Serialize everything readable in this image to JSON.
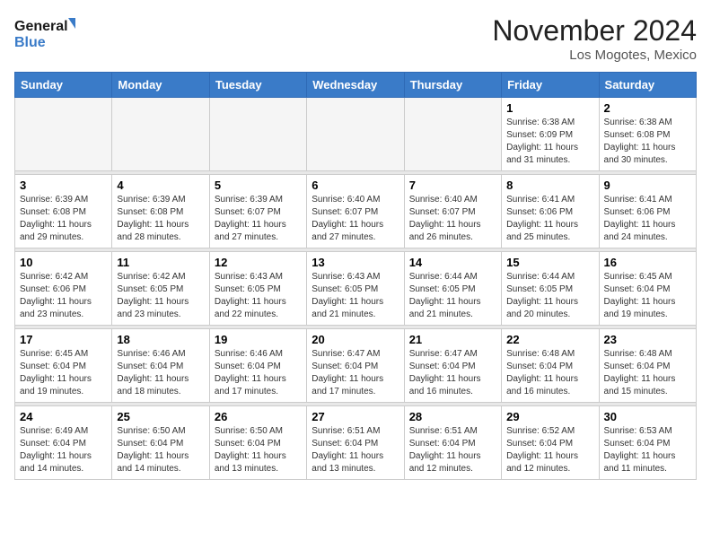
{
  "header": {
    "logo_line1": "General",
    "logo_line2": "Blue",
    "month": "November 2024",
    "location": "Los Mogotes, Mexico"
  },
  "days_of_week": [
    "Sunday",
    "Monday",
    "Tuesday",
    "Wednesday",
    "Thursday",
    "Friday",
    "Saturday"
  ],
  "weeks": [
    [
      {
        "day": "",
        "info": ""
      },
      {
        "day": "",
        "info": ""
      },
      {
        "day": "",
        "info": ""
      },
      {
        "day": "",
        "info": ""
      },
      {
        "day": "",
        "info": ""
      },
      {
        "day": "1",
        "info": "Sunrise: 6:38 AM\nSunset: 6:09 PM\nDaylight: 11 hours and 31 minutes."
      },
      {
        "day": "2",
        "info": "Sunrise: 6:38 AM\nSunset: 6:08 PM\nDaylight: 11 hours and 30 minutes."
      }
    ],
    [
      {
        "day": "3",
        "info": "Sunrise: 6:39 AM\nSunset: 6:08 PM\nDaylight: 11 hours and 29 minutes."
      },
      {
        "day": "4",
        "info": "Sunrise: 6:39 AM\nSunset: 6:08 PM\nDaylight: 11 hours and 28 minutes."
      },
      {
        "day": "5",
        "info": "Sunrise: 6:39 AM\nSunset: 6:07 PM\nDaylight: 11 hours and 27 minutes."
      },
      {
        "day": "6",
        "info": "Sunrise: 6:40 AM\nSunset: 6:07 PM\nDaylight: 11 hours and 27 minutes."
      },
      {
        "day": "7",
        "info": "Sunrise: 6:40 AM\nSunset: 6:07 PM\nDaylight: 11 hours and 26 minutes."
      },
      {
        "day": "8",
        "info": "Sunrise: 6:41 AM\nSunset: 6:06 PM\nDaylight: 11 hours and 25 minutes."
      },
      {
        "day": "9",
        "info": "Sunrise: 6:41 AM\nSunset: 6:06 PM\nDaylight: 11 hours and 24 minutes."
      }
    ],
    [
      {
        "day": "10",
        "info": "Sunrise: 6:42 AM\nSunset: 6:06 PM\nDaylight: 11 hours and 23 minutes."
      },
      {
        "day": "11",
        "info": "Sunrise: 6:42 AM\nSunset: 6:05 PM\nDaylight: 11 hours and 23 minutes."
      },
      {
        "day": "12",
        "info": "Sunrise: 6:43 AM\nSunset: 6:05 PM\nDaylight: 11 hours and 22 minutes."
      },
      {
        "day": "13",
        "info": "Sunrise: 6:43 AM\nSunset: 6:05 PM\nDaylight: 11 hours and 21 minutes."
      },
      {
        "day": "14",
        "info": "Sunrise: 6:44 AM\nSunset: 6:05 PM\nDaylight: 11 hours and 21 minutes."
      },
      {
        "day": "15",
        "info": "Sunrise: 6:44 AM\nSunset: 6:05 PM\nDaylight: 11 hours and 20 minutes."
      },
      {
        "day": "16",
        "info": "Sunrise: 6:45 AM\nSunset: 6:04 PM\nDaylight: 11 hours and 19 minutes."
      }
    ],
    [
      {
        "day": "17",
        "info": "Sunrise: 6:45 AM\nSunset: 6:04 PM\nDaylight: 11 hours and 19 minutes."
      },
      {
        "day": "18",
        "info": "Sunrise: 6:46 AM\nSunset: 6:04 PM\nDaylight: 11 hours and 18 minutes."
      },
      {
        "day": "19",
        "info": "Sunrise: 6:46 AM\nSunset: 6:04 PM\nDaylight: 11 hours and 17 minutes."
      },
      {
        "day": "20",
        "info": "Sunrise: 6:47 AM\nSunset: 6:04 PM\nDaylight: 11 hours and 17 minutes."
      },
      {
        "day": "21",
        "info": "Sunrise: 6:47 AM\nSunset: 6:04 PM\nDaylight: 11 hours and 16 minutes."
      },
      {
        "day": "22",
        "info": "Sunrise: 6:48 AM\nSunset: 6:04 PM\nDaylight: 11 hours and 16 minutes."
      },
      {
        "day": "23",
        "info": "Sunrise: 6:48 AM\nSunset: 6:04 PM\nDaylight: 11 hours and 15 minutes."
      }
    ],
    [
      {
        "day": "24",
        "info": "Sunrise: 6:49 AM\nSunset: 6:04 PM\nDaylight: 11 hours and 14 minutes."
      },
      {
        "day": "25",
        "info": "Sunrise: 6:50 AM\nSunset: 6:04 PM\nDaylight: 11 hours and 14 minutes."
      },
      {
        "day": "26",
        "info": "Sunrise: 6:50 AM\nSunset: 6:04 PM\nDaylight: 11 hours and 13 minutes."
      },
      {
        "day": "27",
        "info": "Sunrise: 6:51 AM\nSunset: 6:04 PM\nDaylight: 11 hours and 13 minutes."
      },
      {
        "day": "28",
        "info": "Sunrise: 6:51 AM\nSunset: 6:04 PM\nDaylight: 11 hours and 12 minutes."
      },
      {
        "day": "29",
        "info": "Sunrise: 6:52 AM\nSunset: 6:04 PM\nDaylight: 11 hours and 12 minutes."
      },
      {
        "day": "30",
        "info": "Sunrise: 6:53 AM\nSunset: 6:04 PM\nDaylight: 11 hours and 11 minutes."
      }
    ]
  ]
}
